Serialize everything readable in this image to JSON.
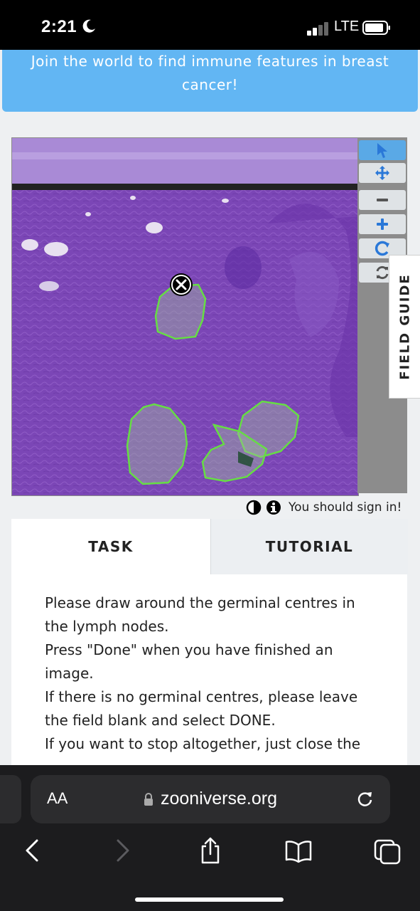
{
  "status_bar": {
    "time": "2:21",
    "network": "LTE"
  },
  "banner": {
    "text": "Join the world to find immune features in breast cancer!"
  },
  "field_guide": {
    "label": "FIELD GUIDE"
  },
  "info": {
    "sign_in_text": "You should sign in!"
  },
  "tabs": {
    "task": "TASK",
    "tutorial": "TUTORIAL"
  },
  "task": {
    "lines": [
      "Please draw around the germinal centres in the lymph nodes.",
      "Press \"Done\" when you have finished an image.",
      "If there is no germinal centres, please leave the field blank and select DONE.",
      "If you want to stop altogether, just close the"
    ]
  },
  "browser": {
    "text_size_label": "AA",
    "url": "zooniverse.org"
  },
  "colors": {
    "banner": "#62b6f3",
    "outline": "#66dd44",
    "tissue": "#7c48b8",
    "active_tool": "#5aa9e6"
  }
}
